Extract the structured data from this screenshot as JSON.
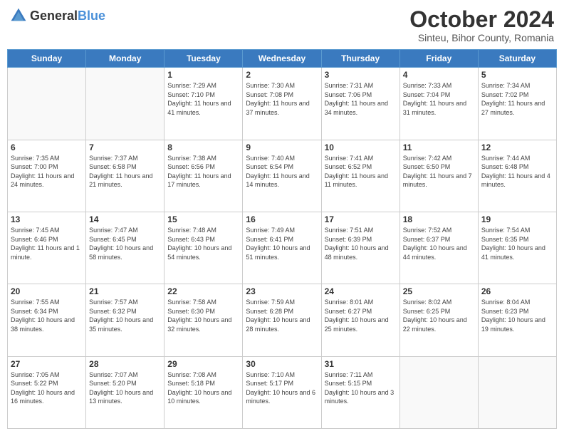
{
  "header": {
    "logo_general": "General",
    "logo_blue": "Blue",
    "month_title": "October 2024",
    "location": "Sinteu, Bihor County, Romania"
  },
  "days_of_week": [
    "Sunday",
    "Monday",
    "Tuesday",
    "Wednesday",
    "Thursday",
    "Friday",
    "Saturday"
  ],
  "weeks": [
    [
      {
        "day": "",
        "info": ""
      },
      {
        "day": "",
        "info": ""
      },
      {
        "day": "1",
        "info": "Sunrise: 7:29 AM\nSunset: 7:10 PM\nDaylight: 11 hours and 41 minutes."
      },
      {
        "day": "2",
        "info": "Sunrise: 7:30 AM\nSunset: 7:08 PM\nDaylight: 11 hours and 37 minutes."
      },
      {
        "day": "3",
        "info": "Sunrise: 7:31 AM\nSunset: 7:06 PM\nDaylight: 11 hours and 34 minutes."
      },
      {
        "day": "4",
        "info": "Sunrise: 7:33 AM\nSunset: 7:04 PM\nDaylight: 11 hours and 31 minutes."
      },
      {
        "day": "5",
        "info": "Sunrise: 7:34 AM\nSunset: 7:02 PM\nDaylight: 11 hours and 27 minutes."
      }
    ],
    [
      {
        "day": "6",
        "info": "Sunrise: 7:35 AM\nSunset: 7:00 PM\nDaylight: 11 hours and 24 minutes."
      },
      {
        "day": "7",
        "info": "Sunrise: 7:37 AM\nSunset: 6:58 PM\nDaylight: 11 hours and 21 minutes."
      },
      {
        "day": "8",
        "info": "Sunrise: 7:38 AM\nSunset: 6:56 PM\nDaylight: 11 hours and 17 minutes."
      },
      {
        "day": "9",
        "info": "Sunrise: 7:40 AM\nSunset: 6:54 PM\nDaylight: 11 hours and 14 minutes."
      },
      {
        "day": "10",
        "info": "Sunrise: 7:41 AM\nSunset: 6:52 PM\nDaylight: 11 hours and 11 minutes."
      },
      {
        "day": "11",
        "info": "Sunrise: 7:42 AM\nSunset: 6:50 PM\nDaylight: 11 hours and 7 minutes."
      },
      {
        "day": "12",
        "info": "Sunrise: 7:44 AM\nSunset: 6:48 PM\nDaylight: 11 hours and 4 minutes."
      }
    ],
    [
      {
        "day": "13",
        "info": "Sunrise: 7:45 AM\nSunset: 6:46 PM\nDaylight: 11 hours and 1 minute."
      },
      {
        "day": "14",
        "info": "Sunrise: 7:47 AM\nSunset: 6:45 PM\nDaylight: 10 hours and 58 minutes."
      },
      {
        "day": "15",
        "info": "Sunrise: 7:48 AM\nSunset: 6:43 PM\nDaylight: 10 hours and 54 minutes."
      },
      {
        "day": "16",
        "info": "Sunrise: 7:49 AM\nSunset: 6:41 PM\nDaylight: 10 hours and 51 minutes."
      },
      {
        "day": "17",
        "info": "Sunrise: 7:51 AM\nSunset: 6:39 PM\nDaylight: 10 hours and 48 minutes."
      },
      {
        "day": "18",
        "info": "Sunrise: 7:52 AM\nSunset: 6:37 PM\nDaylight: 10 hours and 44 minutes."
      },
      {
        "day": "19",
        "info": "Sunrise: 7:54 AM\nSunset: 6:35 PM\nDaylight: 10 hours and 41 minutes."
      }
    ],
    [
      {
        "day": "20",
        "info": "Sunrise: 7:55 AM\nSunset: 6:34 PM\nDaylight: 10 hours and 38 minutes."
      },
      {
        "day": "21",
        "info": "Sunrise: 7:57 AM\nSunset: 6:32 PM\nDaylight: 10 hours and 35 minutes."
      },
      {
        "day": "22",
        "info": "Sunrise: 7:58 AM\nSunset: 6:30 PM\nDaylight: 10 hours and 32 minutes."
      },
      {
        "day": "23",
        "info": "Sunrise: 7:59 AM\nSunset: 6:28 PM\nDaylight: 10 hours and 28 minutes."
      },
      {
        "day": "24",
        "info": "Sunrise: 8:01 AM\nSunset: 6:27 PM\nDaylight: 10 hours and 25 minutes."
      },
      {
        "day": "25",
        "info": "Sunrise: 8:02 AM\nSunset: 6:25 PM\nDaylight: 10 hours and 22 minutes."
      },
      {
        "day": "26",
        "info": "Sunrise: 8:04 AM\nSunset: 6:23 PM\nDaylight: 10 hours and 19 minutes."
      }
    ],
    [
      {
        "day": "27",
        "info": "Sunrise: 7:05 AM\nSunset: 5:22 PM\nDaylight: 10 hours and 16 minutes."
      },
      {
        "day": "28",
        "info": "Sunrise: 7:07 AM\nSunset: 5:20 PM\nDaylight: 10 hours and 13 minutes."
      },
      {
        "day": "29",
        "info": "Sunrise: 7:08 AM\nSunset: 5:18 PM\nDaylight: 10 hours and 10 minutes."
      },
      {
        "day": "30",
        "info": "Sunrise: 7:10 AM\nSunset: 5:17 PM\nDaylight: 10 hours and 6 minutes."
      },
      {
        "day": "31",
        "info": "Sunrise: 7:11 AM\nSunset: 5:15 PM\nDaylight: 10 hours and 3 minutes."
      },
      {
        "day": "",
        "info": ""
      },
      {
        "day": "",
        "info": ""
      }
    ]
  ]
}
